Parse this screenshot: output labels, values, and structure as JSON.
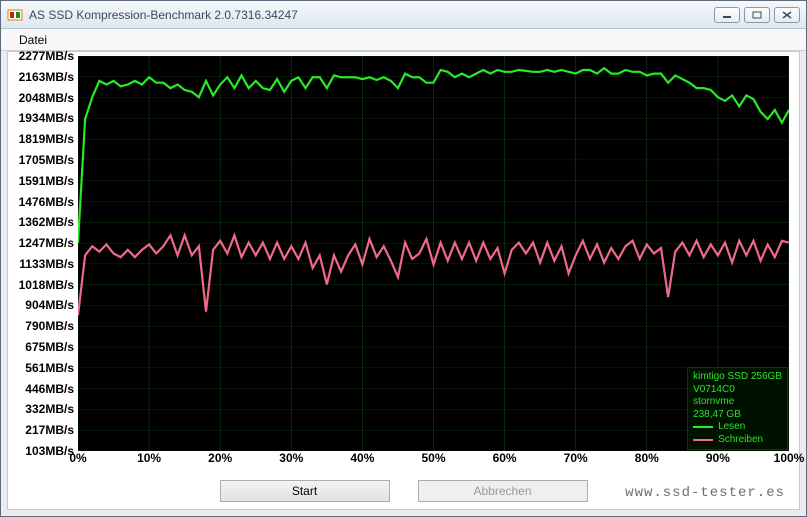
{
  "window": {
    "title": "AS SSD Kompression-Benchmark 2.0.7316.34247"
  },
  "menu": {
    "file": "Datei"
  },
  "buttons": {
    "start": "Start",
    "cancel": "Abbrechen"
  },
  "legend": {
    "drive": "kimtigo SSD 256GB",
    "fw": "V0714C0",
    "nvme": "stornvme",
    "size": "238,47 GB",
    "read": "Lesen",
    "write": "Schreiben",
    "read_color": "#29e929",
    "write_color": "#ef6a89"
  },
  "watermark": "www.ssd-tester.es",
  "chart_data": {
    "type": "line",
    "xlabel": "",
    "ylabel": "MB/s",
    "ylim": [
      103,
      2277
    ],
    "xlim": [
      0,
      100
    ],
    "y_ticks": [
      103,
      217,
      332,
      446,
      561,
      675,
      790,
      904,
      1018,
      1133,
      1247,
      1362,
      1476,
      1591,
      1705,
      1819,
      1934,
      2048,
      2163,
      2277
    ],
    "y_tick_labels": [
      "103MB/s",
      "217MB/s",
      "332MB/s",
      "446MB/s",
      "561MB/s",
      "675MB/s",
      "790MB/s",
      "904MB/s",
      "1018MB/s",
      "1133MB/s",
      "1247MB/s",
      "1362MB/s",
      "1476MB/s",
      "1591MB/s",
      "1705MB/s",
      "1819MB/s",
      "1934MB/s",
      "2048MB/s",
      "2163MB/s",
      "2277MB/s"
    ],
    "x_ticks": [
      0,
      10,
      20,
      30,
      40,
      50,
      60,
      70,
      80,
      90,
      100
    ],
    "x_tick_labels": [
      "0%",
      "10%",
      "20%",
      "30%",
      "40%",
      "50%",
      "60%",
      "70%",
      "80%",
      "90%",
      "100%"
    ],
    "x": [
      0,
      1,
      2,
      3,
      4,
      5,
      6,
      7,
      8,
      9,
      10,
      11,
      12,
      13,
      14,
      15,
      16,
      17,
      18,
      19,
      20,
      21,
      22,
      23,
      24,
      25,
      26,
      27,
      28,
      29,
      30,
      31,
      32,
      33,
      34,
      35,
      36,
      37,
      38,
      39,
      40,
      41,
      42,
      43,
      44,
      45,
      46,
      47,
      48,
      49,
      50,
      51,
      52,
      53,
      54,
      55,
      56,
      57,
      58,
      59,
      60,
      61,
      62,
      63,
      64,
      65,
      66,
      67,
      68,
      69,
      70,
      71,
      72,
      73,
      74,
      75,
      76,
      77,
      78,
      79,
      80,
      81,
      82,
      83,
      84,
      85,
      86,
      87,
      88,
      89,
      90,
      91,
      92,
      93,
      94,
      95,
      96,
      97,
      98,
      99,
      100
    ],
    "series": [
      {
        "name": "Lesen",
        "color": "#29e929",
        "values": [
          1250,
          1930,
          2050,
          2140,
          2120,
          2140,
          2110,
          2120,
          2140,
          2120,
          2160,
          2130,
          2130,
          2100,
          2120,
          2090,
          2080,
          2050,
          2140,
          2060,
          2120,
          2160,
          2100,
          2170,
          2100,
          2140,
          2100,
          2090,
          2150,
          2080,
          2140,
          2160,
          2100,
          2160,
          2160,
          2100,
          2170,
          2160,
          2160,
          2160,
          2150,
          2160,
          2145,
          2160,
          2140,
          2100,
          2180,
          2160,
          2160,
          2130,
          2130,
          2200,
          2190,
          2160,
          2180,
          2160,
          2180,
          2200,
          2180,
          2200,
          2190,
          2190,
          2200,
          2195,
          2190,
          2190,
          2200,
          2190,
          2200,
          2190,
          2180,
          2200,
          2200,
          2180,
          2210,
          2180,
          2180,
          2200,
          2190,
          2190,
          2170,
          2180,
          2180,
          2130,
          2170,
          2150,
          2130,
          2100,
          2100,
          2090,
          2050,
          2030,
          2060,
          2000,
          2060,
          2040,
          1970,
          1930,
          1980,
          1910,
          1980
        ]
      },
      {
        "name": "Schreiben",
        "color": "#ef6a89",
        "values": [
          850,
          1180,
          1230,
          1200,
          1240,
          1190,
          1170,
          1210,
          1170,
          1210,
          1240,
          1190,
          1230,
          1290,
          1180,
          1290,
          1180,
          1230,
          870,
          1210,
          1260,
          1190,
          1290,
          1170,
          1250,
          1180,
          1250,
          1160,
          1250,
          1160,
          1230,
          1160,
          1250,
          1110,
          1180,
          1020,
          1180,
          1090,
          1180,
          1240,
          1130,
          1270,
          1170,
          1230,
          1150,
          1060,
          1250,
          1160,
          1190,
          1270,
          1130,
          1250,
          1150,
          1250,
          1160,
          1250,
          1150,
          1250,
          1160,
          1220,
          1080,
          1210,
          1250,
          1190,
          1250,
          1140,
          1250,
          1150,
          1230,
          1080,
          1180,
          1260,
          1160,
          1240,
          1140,
          1220,
          1160,
          1230,
          1260,
          1160,
          1240,
          1190,
          1220,
          950,
          1200,
          1250,
          1180,
          1260,
          1170,
          1240,
          1180,
          1250,
          1140,
          1260,
          1180,
          1260,
          1150,
          1240,
          1170,
          1260,
          1250
        ]
      }
    ]
  }
}
